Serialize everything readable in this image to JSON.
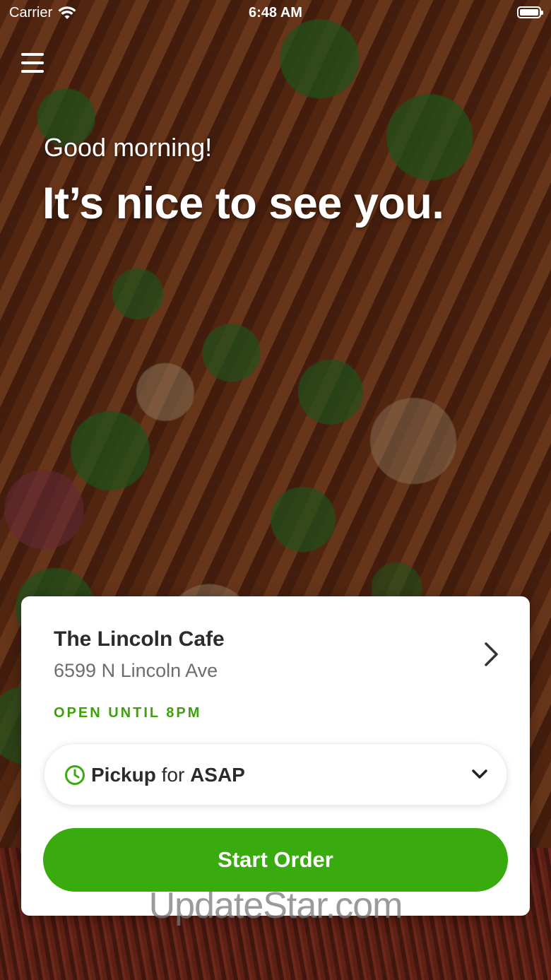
{
  "status_bar": {
    "carrier": "Carrier",
    "time": "6:48 AM"
  },
  "hero": {
    "greeting": "Good morning!",
    "headline": "It’s nice to see you."
  },
  "store": {
    "name": "The Lincoln Cafe",
    "address": "6599 N Lincoln Ave",
    "status": "OPEN UNTIL 8PM"
  },
  "order_mode": {
    "mode": "Pickup",
    "connector": "for",
    "time": "ASAP"
  },
  "actions": {
    "start_order": "Start Order"
  },
  "watermark": "UpdateStar.com",
  "colors": {
    "accent_green": "#3aab0f",
    "status_green": "#3ea10a"
  },
  "icons": [
    "wifi-icon",
    "battery-icon",
    "menu-icon",
    "chevron-right-icon",
    "clock-icon",
    "chevron-down-icon"
  ]
}
